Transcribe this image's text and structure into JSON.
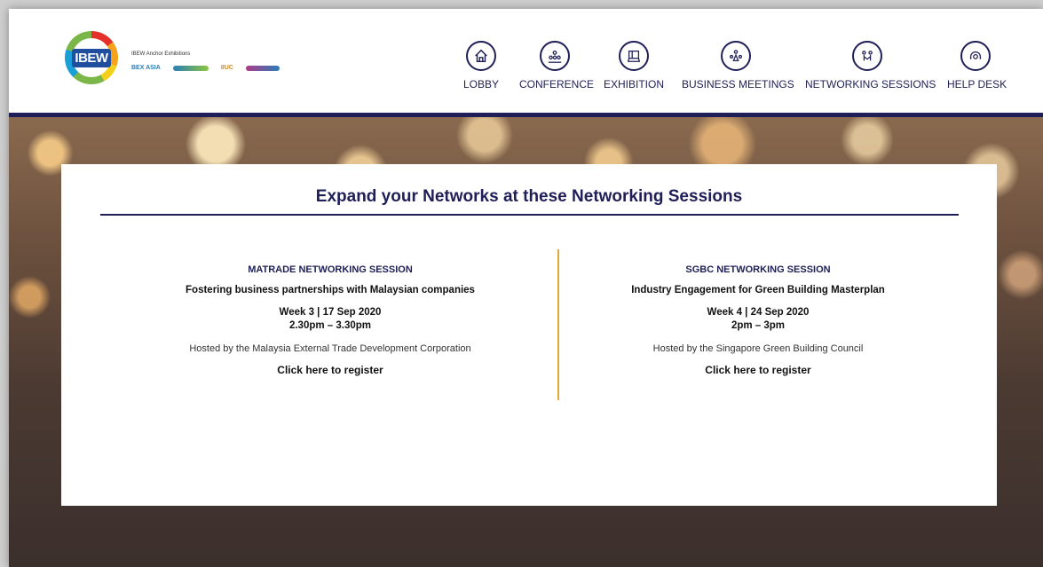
{
  "logo": {
    "main_text": "IBEW",
    "anchor_label": "IBEW Anchor Exhibitions",
    "partners": [
      "BEX ASIA",
      "",
      "",
      ""
    ]
  },
  "nav": [
    {
      "label": "LOBBY",
      "icon": "home-icon"
    },
    {
      "label": "CONFERENCE",
      "icon": "audience-icon"
    },
    {
      "label": "EXHIBITION",
      "icon": "booth-icon"
    },
    {
      "label": "BUSINESS MEETINGS",
      "icon": "meeting-icon"
    },
    {
      "label": "NETWORKING SESSIONS",
      "icon": "network-icon"
    },
    {
      "label": "HELP DESK",
      "icon": "headset-icon"
    }
  ],
  "card": {
    "title": "Expand your Networks at these Networking Sessions",
    "sessions": [
      {
        "name": "MATRADE NETWORKING SESSION",
        "topic": "Fostering business partnerships with Malaysian companies",
        "date": "Week 3 | 17 Sep 2020",
        "time": "2.30pm – 3.30pm",
        "host": "Hosted by the Malaysia External Trade Development Corporation",
        "register": "Click here to register"
      },
      {
        "name": "SGBC NETWORKING SESSION",
        "topic": "Industry Engagement for Green Building Masterplan",
        "date": "Week 4 | 24 Sep 2020",
        "time": "2pm – 3pm",
        "host": "Hosted by the Singapore Green Building Council",
        "register": "Click here to register"
      }
    ]
  },
  "colors": {
    "navy": "#1f1f57",
    "divider_gold": "#e0a83a"
  }
}
